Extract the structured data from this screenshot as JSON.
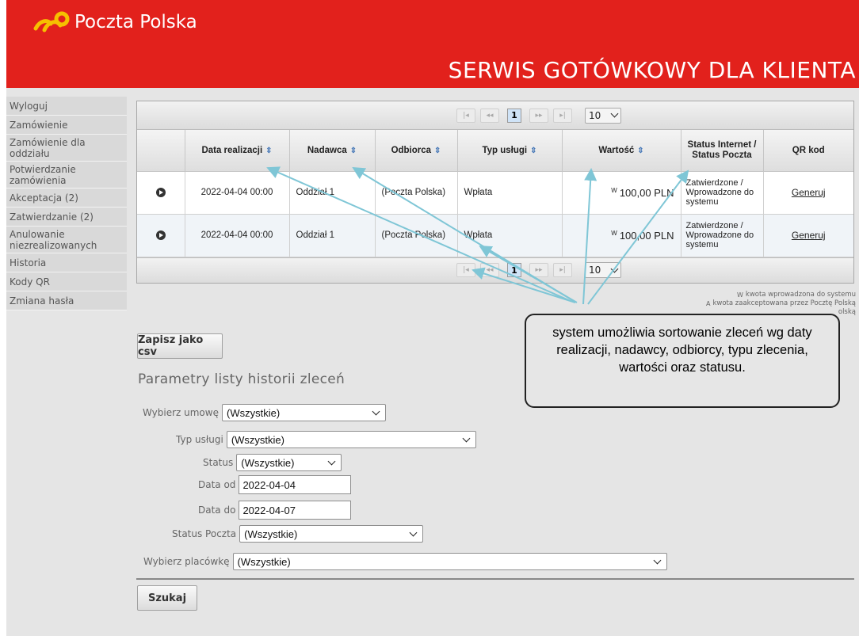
{
  "header": {
    "logo_text": "Poczta Polska",
    "service_title": "SERWIS GOTÓWKOWY DLA KLIENTA",
    "brand_color": "#e2211c",
    "logo_color": "#f6c000"
  },
  "sidebar": {
    "items": [
      {
        "label": "Wyloguj"
      },
      {
        "label": "Zamówienie"
      },
      {
        "label": "Zamówienie dla oddziału"
      },
      {
        "label": "Potwierdzanie zamówienia"
      },
      {
        "label": "Akceptacja (2)"
      },
      {
        "label": "Zatwierdzanie (2)"
      },
      {
        "label": "Anulowanie niezrealizowanych"
      },
      {
        "label": "Historia"
      },
      {
        "label": "Kody QR"
      },
      {
        "label": "Zmiana hasła"
      }
    ]
  },
  "pager": {
    "first": "|◂",
    "prev": "◂◂",
    "current_page": "1",
    "next": "▸▸",
    "last": "▸|",
    "page_size": "10"
  },
  "table": {
    "columns": [
      "",
      "Data realizacji",
      "Nadawca",
      "Odbiorca",
      "Typ usługi",
      "Wartość",
      "Status Internet / Status Poczta",
      "QR kod"
    ],
    "sort_icon": "sort-arrows-icon",
    "rows": [
      {
        "date": "2022-04-04 00:00",
        "sender": "Oddział 1",
        "recipient": "(Poczta Polska)",
        "service": "Wpłata",
        "value_flag": "W",
        "value": "100,00 PLN",
        "status": "Zatwierdzone / Wprowadzone do systemu",
        "qr": "Generuj"
      },
      {
        "date": "2022-04-04 00:00",
        "sender": "Oddział 1",
        "recipient": "(Poczta Polska)",
        "service": "Wpłata",
        "value_flag": "W",
        "value": "100,00 PLN",
        "status": "Zatwierdzone / Wprowadzone do systemu",
        "qr": "Generuj"
      }
    ]
  },
  "legend": {
    "line1_flag": "W",
    "line1": "kwota wprowadzona do systemu",
    "line2_flag": "A",
    "line2": "kwota zaakceptowana przez Pocztę Polską",
    "line3": "olską"
  },
  "callout": {
    "text": "system umożliwia sortowanie zleceń wg daty realizacji, nadawcy, odbiorcy, typu zlecenia, wartości oraz statusu."
  },
  "buttons": {
    "csv": "Zapisz jako csv",
    "search": "Szukaj"
  },
  "form": {
    "title": "Parametry listy historii zleceń",
    "contract": {
      "label": "Wybierz umowę",
      "value": "(Wszystkie)"
    },
    "service_type": {
      "label": "Typ usługi",
      "value": "(Wszystkie)"
    },
    "status": {
      "label": "Status",
      "value": "(Wszystkie)"
    },
    "date_from": {
      "label": "Data od",
      "value": "2022-04-04"
    },
    "date_to": {
      "label": "Data do",
      "value": "2022-04-07"
    },
    "post_status": {
      "label": "Status Poczta",
      "value": "(Wszystkie)"
    },
    "office": {
      "label": "Wybierz placówkę",
      "value": "(Wszystkie)"
    }
  }
}
